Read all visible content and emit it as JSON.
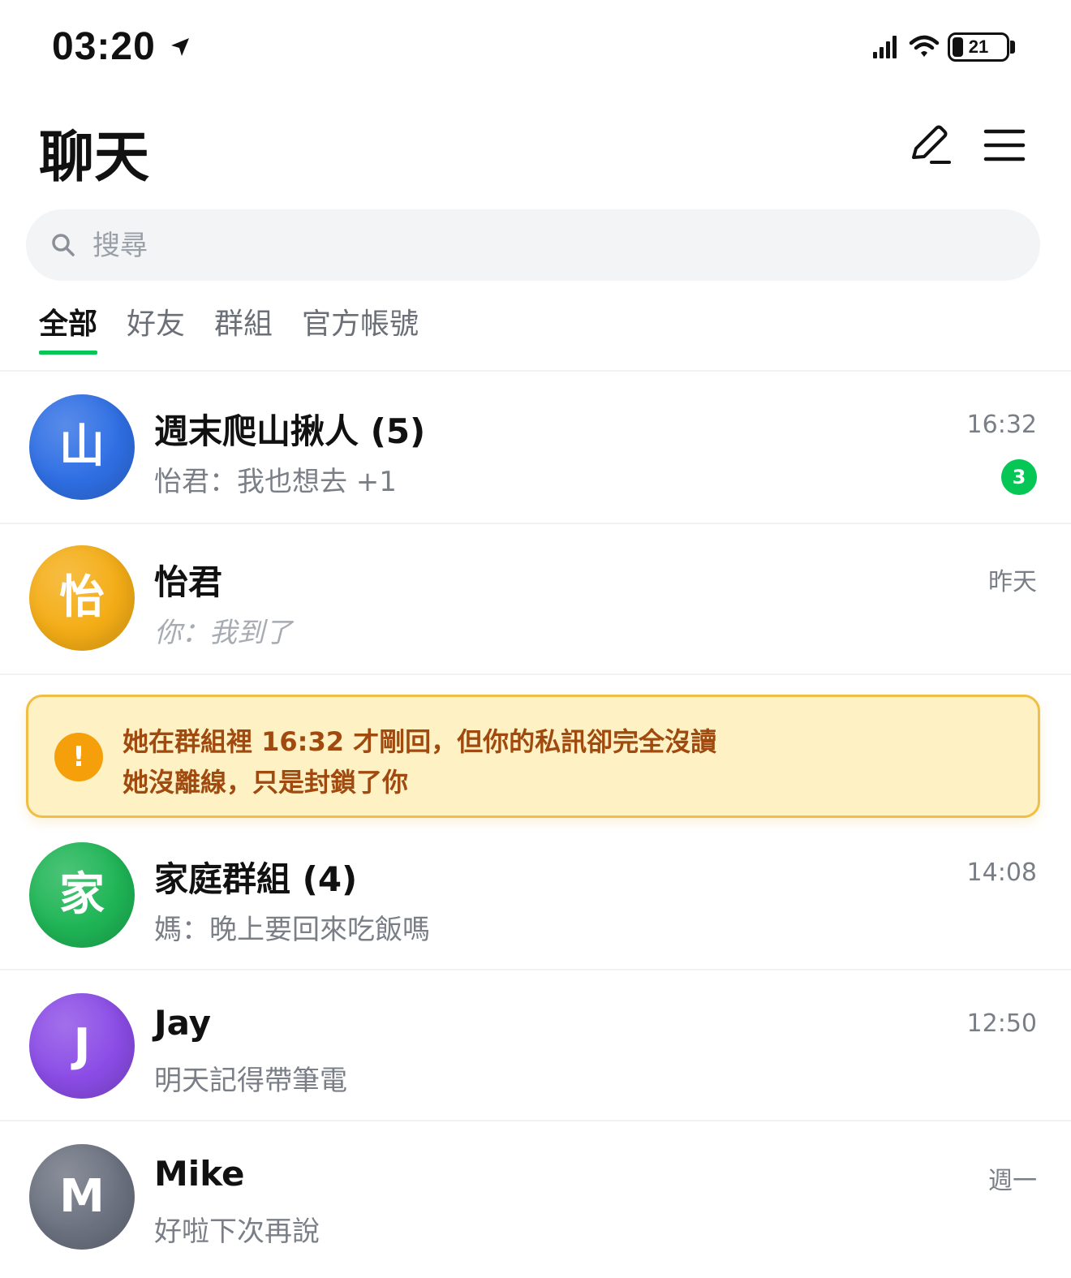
{
  "status_bar": {
    "time": "03:20",
    "battery": "21",
    "battery_level": 0.21
  },
  "header": {
    "title": "聊天"
  },
  "search": {
    "placeholder": "搜尋",
    "value": ""
  },
  "tabs": [
    {
      "label": "全部",
      "active": true
    },
    {
      "label": "好友",
      "active": false
    },
    {
      "label": "群組",
      "active": false
    },
    {
      "label": "官方帳號",
      "active": false
    }
  ],
  "chats": [
    {
      "avatar_text": "山",
      "avatar_color": "#2f6fe4",
      "name": "週末爬山揪人 (5)",
      "preview": "怡君：我也想去 +1",
      "time": "16:32",
      "unread": "3"
    },
    {
      "avatar_text": "怡",
      "avatar_color": "#f4ad16",
      "name": "怡君",
      "preview": "你：我到了",
      "time": "昨天"
    },
    {
      "avatar_text": "家",
      "avatar_color": "#1fb556",
      "name": "家庭群組 (4)",
      "preview": "媽：晚上要回來吃飯嗎",
      "time": "14:08"
    },
    {
      "avatar_text": "J",
      "avatar_color": "#8b4ce6",
      "name": "Jay",
      "preview": "明天記得帶筆電",
      "time": "12:50"
    },
    {
      "avatar_text": "M",
      "avatar_color": "#6c7280",
      "name": "Mike",
      "preview": "好啦下次再說",
      "time": "週一"
    }
  ],
  "alert": {
    "icon": "!",
    "line1": "她在群組裡 16:32 才剛回，但你的私訊卻完全沒讀",
    "line2": "她沒離線，只是封鎖了你"
  },
  "colors": {
    "accent_green": "#06c755",
    "alert_bg": "#fef2c4",
    "alert_border": "#f1be45",
    "alert_text": "#a04a10"
  }
}
